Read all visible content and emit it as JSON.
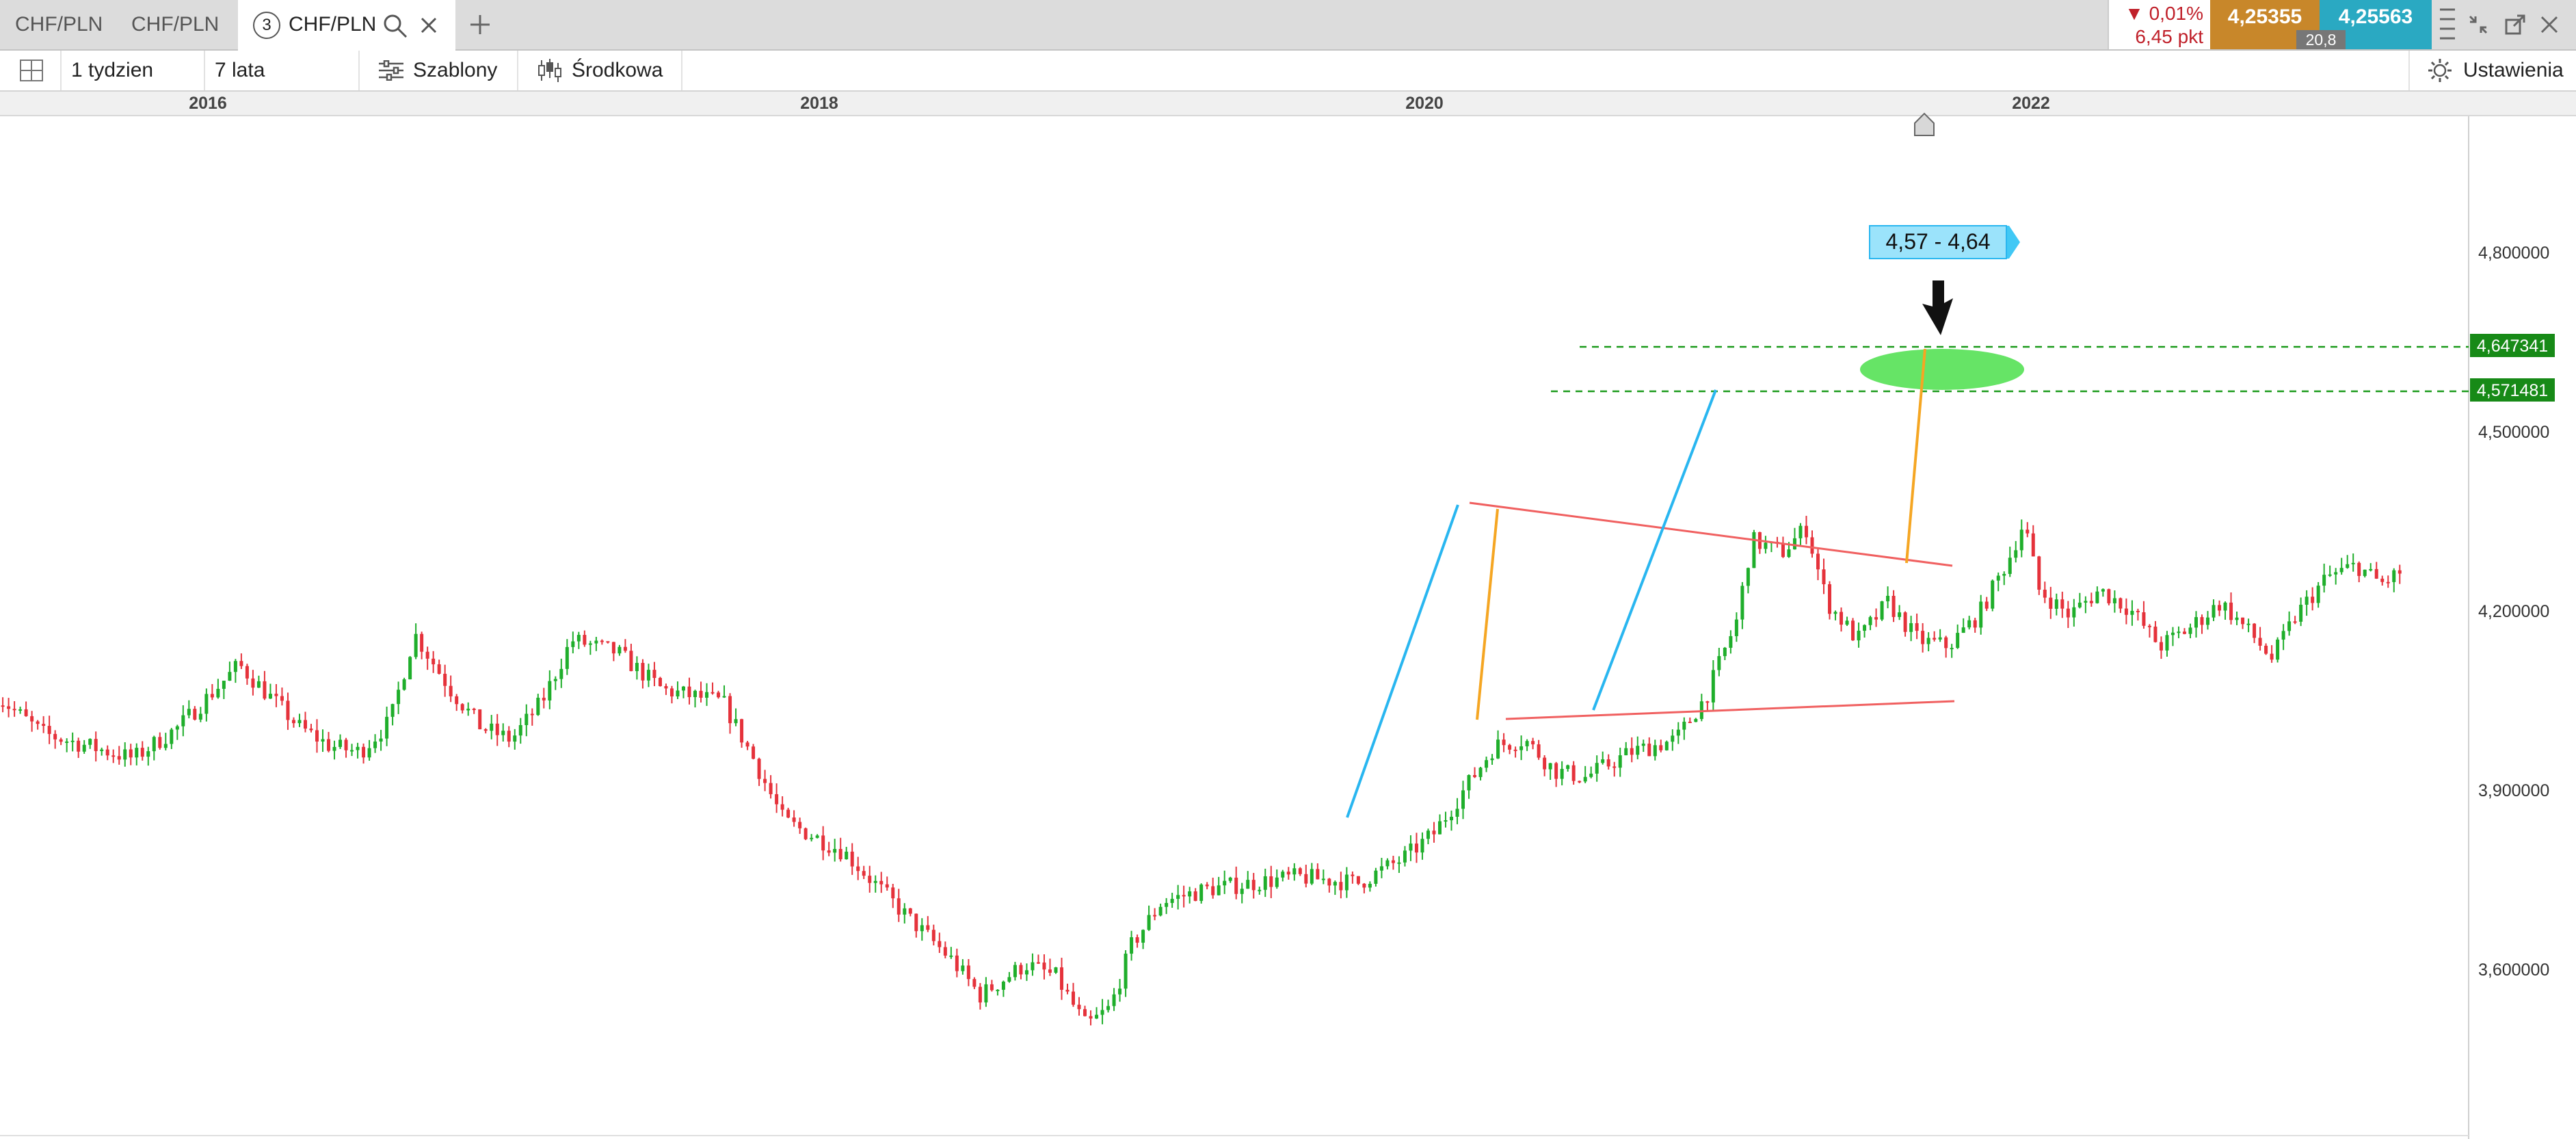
{
  "tabs": [
    {
      "label": "CHF/PLN"
    },
    {
      "label": "CHF/PLN"
    },
    {
      "label": "CHF/PLN",
      "number": "3"
    }
  ],
  "quote": {
    "change_pct": "▼ 0,01%",
    "change_pts": "6,45 pkt",
    "bid": "4,25355",
    "ask": "4,25563",
    "spread": "20,8"
  },
  "toolbar": {
    "interval": "1 tydzien",
    "range": "7 lata",
    "templates": "Szablony",
    "mode": "Środkowa",
    "settings": "Ustawienia"
  },
  "colors": {
    "up": "#1fae2b",
    "down": "#e5323b",
    "bid_bg": "#c8872a",
    "ask_bg": "#2aa9c2",
    "target_zone": "#5ee35e",
    "triangle": "#f06060",
    "cyan_line": "#29b6f0",
    "orange_line": "#f5a623"
  },
  "chart_data": {
    "type": "candlestick",
    "instrument": "CHF/PLN",
    "x_ticks": [
      "2016",
      "2018",
      "2020",
      "2022"
    ],
    "y_ticks": [
      "4,800000",
      "4,500000",
      "4,200000",
      "3,900000",
      "3,600000"
    ],
    "ylim": [
      3.345,
      4.98
    ],
    "xlim": [
      2015.31,
      2023.47
    ],
    "price_labels": [
      "4,647341",
      "4,571481"
    ],
    "target_label": "4,57 - 4,64",
    "key_points": [
      [
        2015.3,
        4.05
      ],
      [
        2015.45,
        3.99
      ],
      [
        2015.6,
        3.97
      ],
      [
        2015.75,
        3.95
      ],
      [
        2015.9,
        4.0
      ],
      [
        2016.1,
        4.1
      ],
      [
        2016.2,
        4.05
      ],
      [
        2016.3,
        4.0
      ],
      [
        2016.4,
        3.97
      ],
      [
        2016.5,
        3.96
      ],
      [
        2016.6,
        4.01
      ],
      [
        2016.68,
        4.15
      ],
      [
        2016.8,
        4.06
      ],
      [
        2016.9,
        4.0
      ],
      [
        2017.0,
        3.98
      ],
      [
        2017.1,
        4.04
      ],
      [
        2017.2,
        4.14
      ],
      [
        2017.35,
        4.12
      ],
      [
        2017.5,
        4.06
      ],
      [
        2017.7,
        4.04
      ],
      [
        2017.8,
        3.95
      ],
      [
        2017.9,
        3.85
      ],
      [
        2018.1,
        3.8
      ],
      [
        2018.3,
        3.7
      ],
      [
        2018.45,
        3.63
      ],
      [
        2018.55,
        3.57
      ],
      [
        2018.7,
        3.62
      ],
      [
        2018.8,
        3.6
      ],
      [
        2018.9,
        3.52
      ],
      [
        2018.98,
        3.55
      ],
      [
        2019.05,
        3.65
      ],
      [
        2019.15,
        3.72
      ],
      [
        2019.3,
        3.74
      ],
      [
        2019.45,
        3.75
      ],
      [
        2019.6,
        3.76
      ],
      [
        2019.8,
        3.75
      ],
      [
        2019.95,
        3.79
      ],
      [
        2020.05,
        3.83
      ],
      [
        2020.15,
        3.9
      ],
      [
        2020.25,
        3.97
      ],
      [
        2020.35,
        3.98
      ],
      [
        2020.45,
        3.93
      ],
      [
        2020.55,
        3.92
      ],
      [
        2020.7,
        3.96
      ],
      [
        2020.85,
        3.98
      ],
      [
        2020.95,
        4.05
      ],
      [
        2021.05,
        4.17
      ],
      [
        2021.1,
        4.3
      ],
      [
        2021.2,
        4.28
      ],
      [
        2021.28,
        4.32
      ],
      [
        2021.35,
        4.2
      ],
      [
        2021.45,
        4.14
      ],
      [
        2021.55,
        4.2
      ],
      [
        2021.65,
        4.14
      ],
      [
        2021.75,
        4.13
      ],
      [
        2021.85,
        4.18
      ],
      [
        2021.95,
        4.27
      ],
      [
        2022.0,
        4.33
      ],
      [
        2022.05,
        4.22
      ],
      [
        2022.15,
        4.18
      ],
      [
        2022.25,
        4.22
      ],
      [
        2022.35,
        4.19
      ],
      [
        2022.45,
        4.13
      ],
      [
        2022.55,
        4.16
      ],
      [
        2022.65,
        4.2
      ],
      [
        2022.75,
        4.15
      ],
      [
        2022.82,
        4.11
      ],
      [
        2022.9,
        4.18
      ],
      [
        2023.0,
        4.24
      ],
      [
        2023.1,
        4.26
      ],
      [
        2023.18,
        4.23
      ],
      [
        2023.25,
        4.25
      ]
    ],
    "grid": false
  }
}
